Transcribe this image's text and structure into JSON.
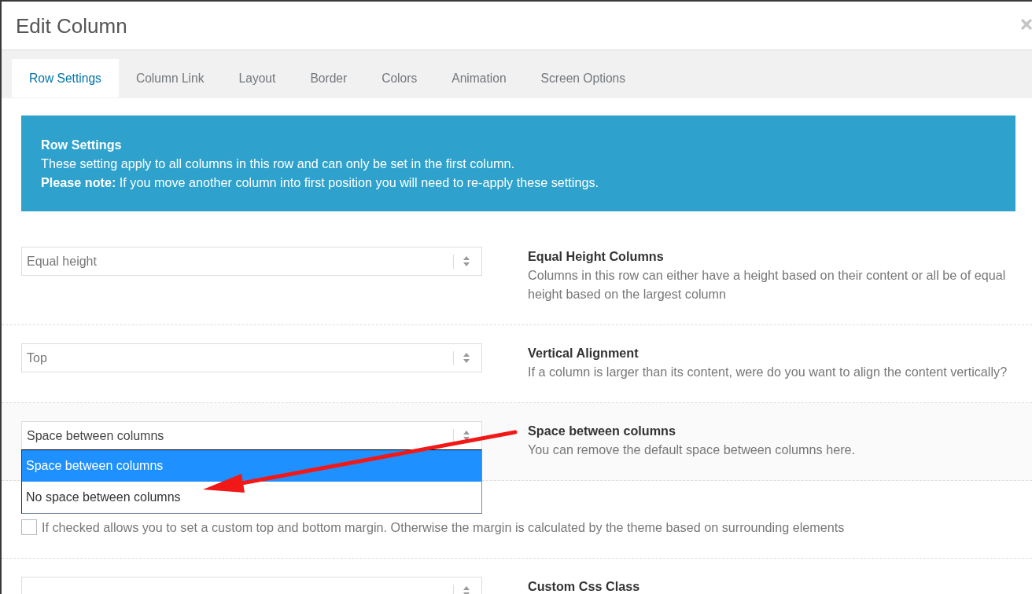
{
  "window": {
    "title": "Edit Column"
  },
  "tabs": [
    {
      "label": "Row Settings",
      "selected": true
    },
    {
      "label": "Column Link",
      "selected": false
    },
    {
      "label": "Layout",
      "selected": false
    },
    {
      "label": "Border",
      "selected": false
    },
    {
      "label": "Colors",
      "selected": false
    },
    {
      "label": "Animation",
      "selected": false
    },
    {
      "label": "Screen Options",
      "selected": false
    }
  ],
  "notice": {
    "title": "Row Settings",
    "text": "These setting apply to all columns in this row and can only be set in the first column.",
    "note": "**Please note:** If you move another column into first position you will need to re-apply these settings."
  },
  "settings": [
    {
      "kind": "select",
      "value": "Equal height",
      "expanded": false,
      "title": "Equal Height Columns",
      "description": "Columns in this row can either have a height based on their content or all be of equal height based on the largest column"
    },
    {
      "kind": "select",
      "value": "Top",
      "expanded": false,
      "title": "Vertical Alignment",
      "description": "If a column is larger than its content, were do you want to align the content vertically?"
    },
    {
      "kind": "select",
      "value": "Space between columns",
      "expanded": true,
      "options": [
        {
          "label": "Space between columns",
          "selected": true
        },
        {
          "label": "No space between columns",
          "selected": false
        }
      ],
      "title": "Space between columns",
      "description": "You can remove the default space between columns here."
    },
    {
      "kind": "checkbox",
      "checked": false,
      "description": "If checked allows you to set a custom top and bottom margin. Otherwise the margin is calculated by the theme based on surrounding elements"
    },
    {
      "kind": "select",
      "title": "Custom Css Class"
    }
  ]
}
